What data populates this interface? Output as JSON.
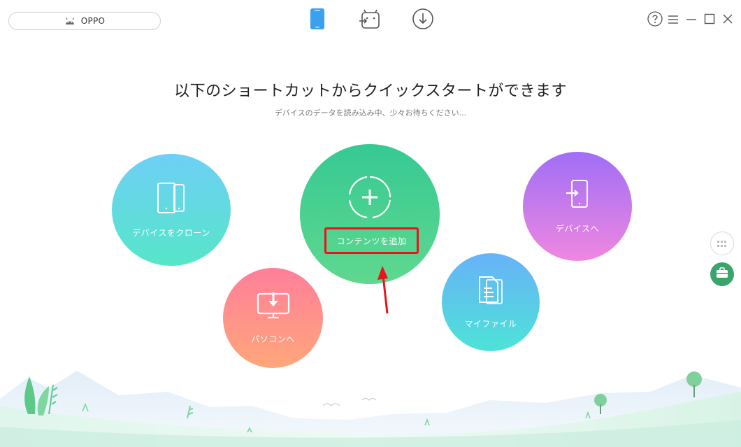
{
  "topbar": {
    "device_name": "OPPO",
    "device_icon": "android-icon",
    "tabs": [
      {
        "icon": "phone-icon",
        "active": true
      },
      {
        "icon": "android-transfer-icon",
        "active": false
      },
      {
        "icon": "download-icon",
        "active": false
      }
    ],
    "window_controls": [
      "help-icon",
      "menu-icon",
      "minimize-icon",
      "maximize-icon",
      "close-icon"
    ]
  },
  "main": {
    "headline": "以下のショートカットからクイックスタートができます",
    "subline": "デバイスのデータを読み込み中、少々お待ちください..."
  },
  "shortcuts": {
    "clone_label": "デバイスをクローン",
    "add_content_label": "コンテンツを追加",
    "to_device_label": "デバイスへ",
    "to_pc_label": "パソコンへ",
    "my_files_label": "マイファイル"
  },
  "sidebar": {
    "items": [
      "grid-icon",
      "toolbox-icon"
    ]
  },
  "colors": {
    "accent_green": "#36c993",
    "highlight_red": "#e8131b",
    "active_tab_blue": "#3aa0f0"
  }
}
